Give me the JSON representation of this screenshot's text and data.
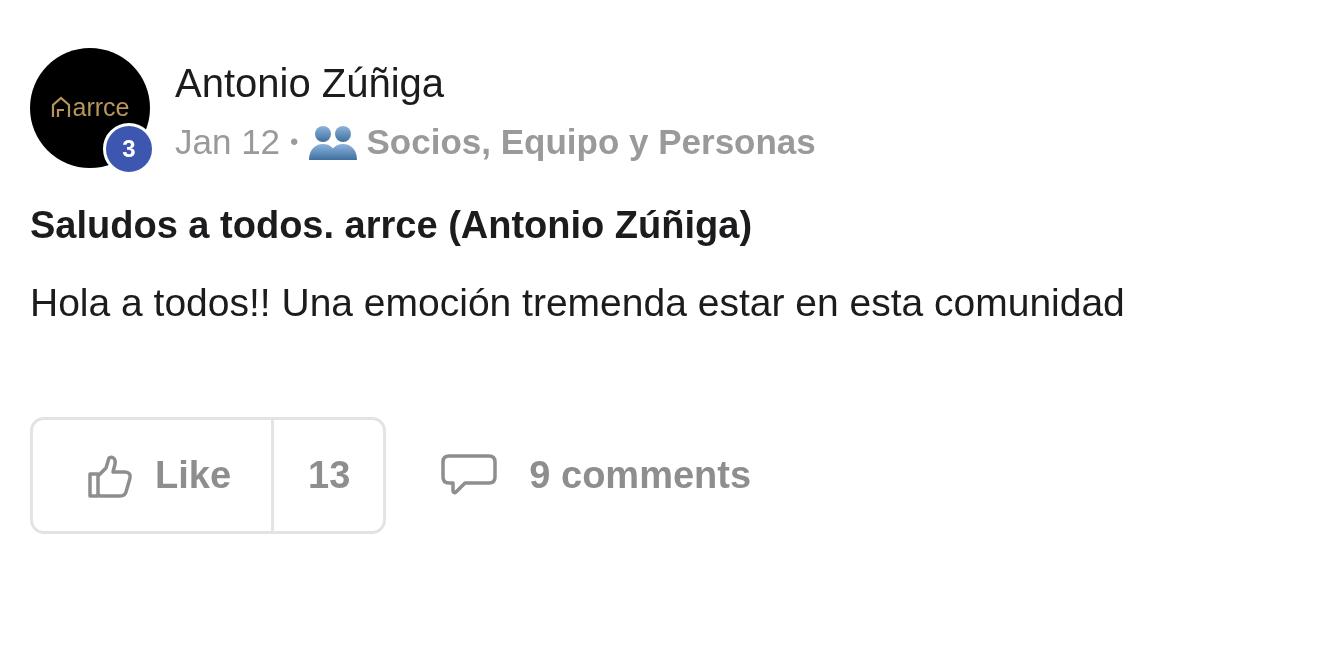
{
  "author": {
    "name": "Antonio Zúñiga",
    "avatar_logo": "arrce",
    "badge": "3"
  },
  "meta": {
    "date": "Jan 12",
    "separator": "•",
    "audience": "Socios, Equipo y Personas"
  },
  "post": {
    "title": "Saludos a todos. arrce (Antonio Zúñiga)",
    "body": "Hola a todos!! Una emoción tremenda estar en esta comunidad"
  },
  "actions": {
    "like_label": "Like",
    "like_count": "13",
    "comments": "9 comments"
  }
}
